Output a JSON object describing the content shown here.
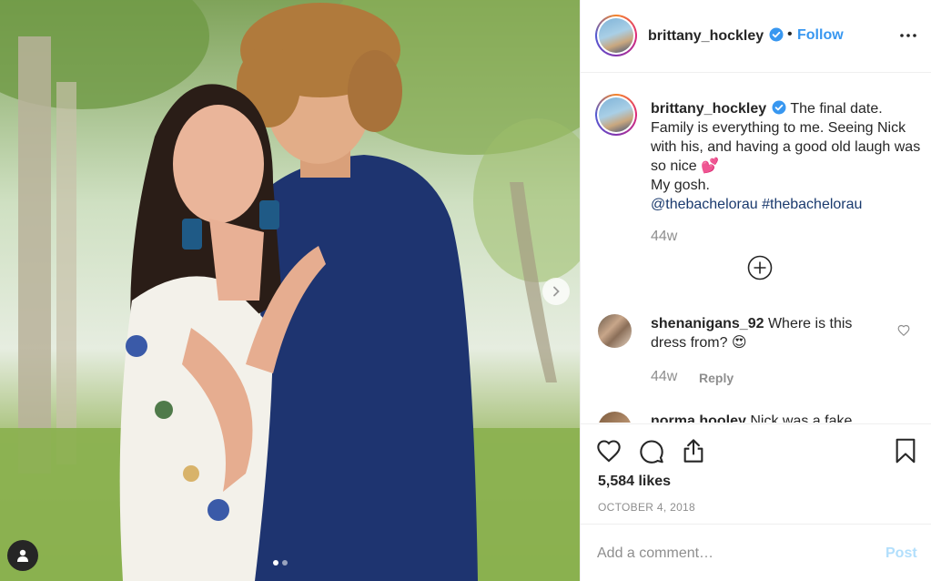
{
  "post": {
    "username": "brittany_hockley",
    "follow_label": "Follow",
    "separator": "•",
    "more_icon": "more-horizontal-icon",
    "verified_icon": "verified-badge-icon"
  },
  "caption": {
    "username": "brittany_hockley",
    "text": " The final date. Family is everything to me. Seeing Nick with his, and having a good old laugh was so nice 💕",
    "line2": "My gosh.",
    "tags": "@thebachelorau #thebachelorau",
    "time": "44w"
  },
  "comments": [
    {
      "username": "shenanigans_92",
      "text": " Where is this dress from? 😍",
      "time": "44w",
      "reply_label": "Reply"
    },
    {
      "username": "norma.hooley",
      "text": " Nick was a fake"
    }
  ],
  "actions": {
    "likes": "5,584 likes",
    "date": "OCTOBER 4, 2018"
  },
  "add_comment": {
    "placeholder": "Add a comment…",
    "post_label": "Post"
  },
  "colors": {
    "link_blue": "#3897f0",
    "post_disabled": "#b2dffc",
    "muted": "#8e8e8e",
    "hashtag": "#1a3a6e"
  }
}
